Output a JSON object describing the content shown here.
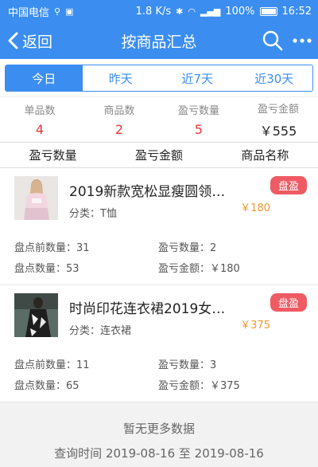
{
  "status_bar": {
    "carrier": "中国电信",
    "network_speed": "1.8 K/s",
    "battery": "100%",
    "time": "16:52"
  },
  "nav": {
    "back_label": "返回",
    "title": "按商品汇总"
  },
  "tabs": [
    {
      "label": "今日",
      "active": true
    },
    {
      "label": "昨天",
      "active": false
    },
    {
      "label": "近7天",
      "active": false
    },
    {
      "label": "近30天",
      "active": false
    }
  ],
  "summary": [
    {
      "label": "单品数",
      "value": "4"
    },
    {
      "label": "商品数",
      "value": "2"
    },
    {
      "label": "盈亏数量",
      "value": "5"
    },
    {
      "label": "盈亏金额",
      "value": "￥555"
    }
  ],
  "table_header": [
    "盈亏数量",
    "盈亏金额",
    "商品名称"
  ],
  "products": [
    {
      "name": "2019新款宽松显瘦圆领…",
      "category": "分类：T恤",
      "badge": "盘盈",
      "price": "￥180",
      "before_qty": "盘点前数量：31",
      "diff_qty": "盈亏数量：2",
      "count_qty": "盘点数量：53",
      "diff_amount": "盈亏金额：￥180"
    },
    {
      "name": "时尚印花连衣裙2019女…",
      "category": "分类：连衣裙",
      "badge": "盘盈",
      "price": "￥375",
      "before_qty": "盘点前数量：11",
      "diff_qty": "盈亏数量：3",
      "count_qty": "盘点数量：65",
      "diff_amount": "盈亏金额：￥375"
    }
  ],
  "footer": {
    "no_more": "暂无更多数据",
    "query_time": "查询时间 2019-08-16 至 2019-08-16"
  }
}
